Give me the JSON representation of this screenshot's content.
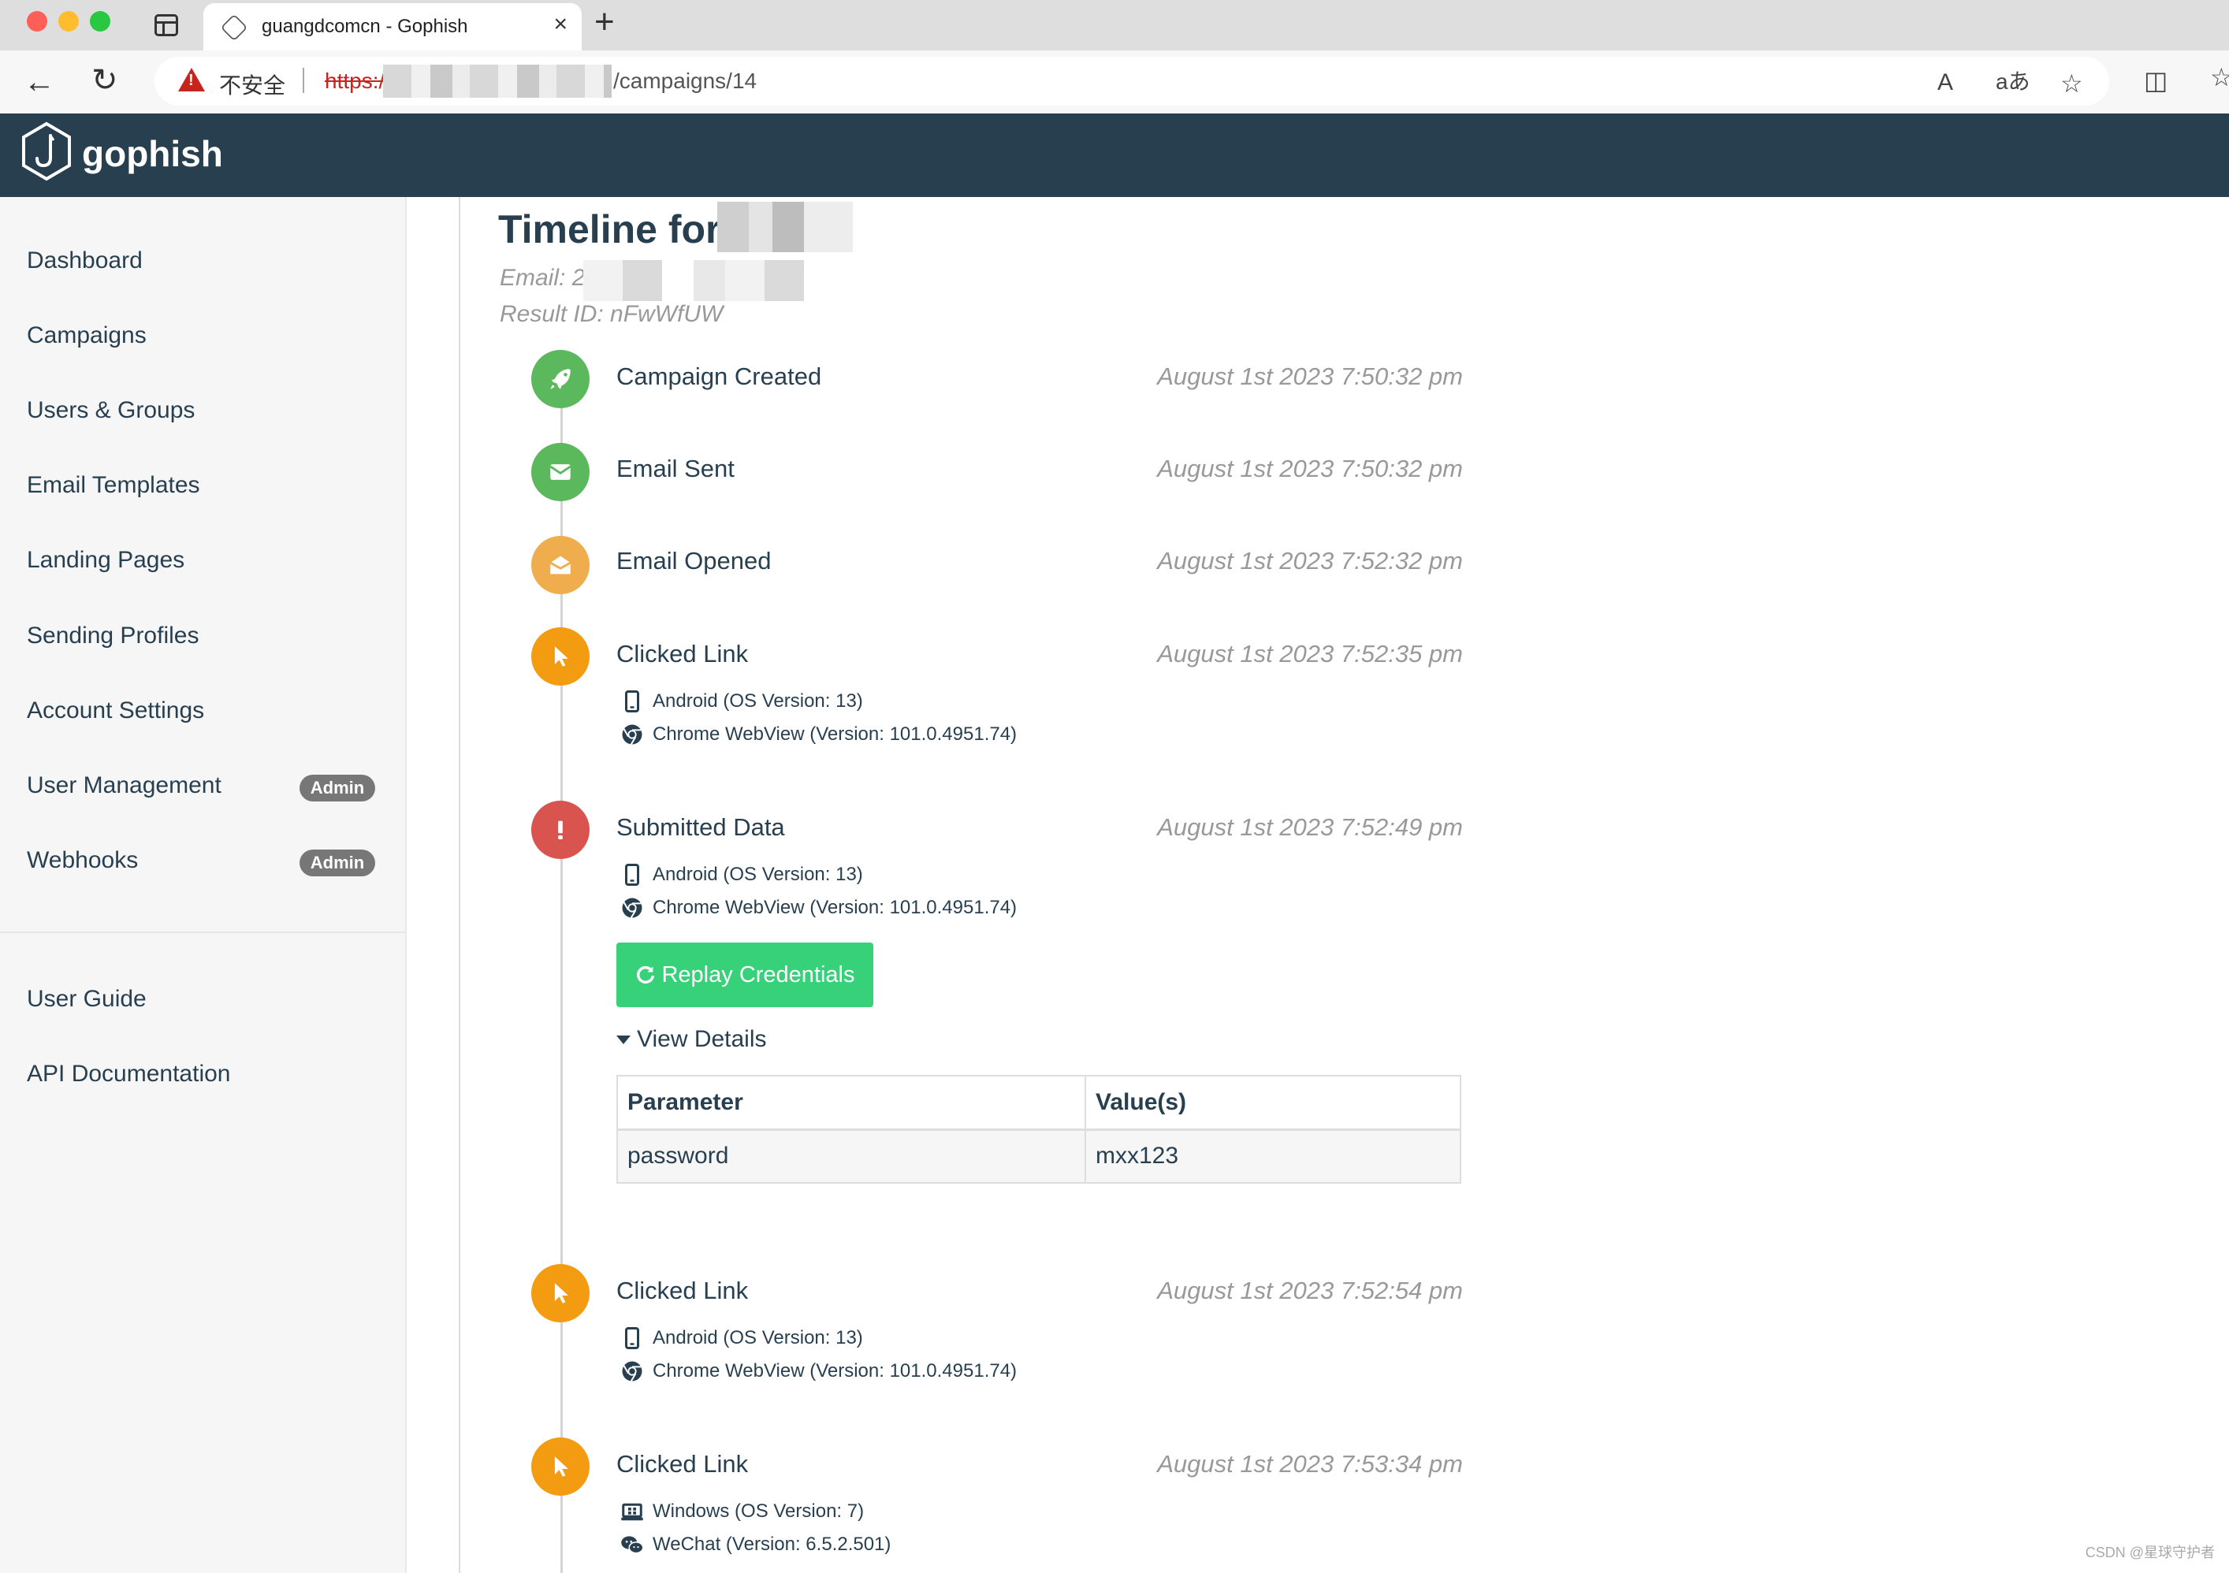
{
  "browser": {
    "tab_title": "guangdcomcn - Gophish",
    "security_warning": "不安全",
    "url_scheme": "https:/",
    "url_path": "/campaigns/14",
    "read_aloud_label": "A",
    "translate_label": "aあ"
  },
  "app": {
    "brand": "gophish"
  },
  "sidebar": {
    "items": [
      {
        "label": "Dashboard"
      },
      {
        "label": "Campaigns"
      },
      {
        "label": "Users & Groups"
      },
      {
        "label": "Email Templates"
      },
      {
        "label": "Landing Pages"
      },
      {
        "label": "Sending Profiles"
      },
      {
        "label": "Account Settings"
      },
      {
        "label": "User Management",
        "badge": "Admin"
      },
      {
        "label": "Webhooks",
        "badge": "Admin"
      }
    ],
    "help_items": [
      {
        "label": "User Guide"
      },
      {
        "label": "API Documentation"
      }
    ]
  },
  "timeline": {
    "title_prefix": "Timeline for",
    "email_prefix": "Email: 2(",
    "result_id": "Result ID: nFwWfUW",
    "events": [
      {
        "message": "Campaign Created",
        "time": "August 1st 2023 7:50:32 pm",
        "icon": "rocket-icon",
        "color": "#5cb85c"
      },
      {
        "message": "Email Sent",
        "time": "August 1st 2023 7:50:32 pm",
        "icon": "envelope-icon",
        "color": "#5cb85c"
      },
      {
        "message": "Email Opened",
        "time": "August 1st 2023 7:52:32 pm",
        "icon": "envelope-open-icon",
        "color": "#f0ad4e"
      },
      {
        "message": "Clicked Link",
        "time": "August 1st 2023 7:52:35 pm",
        "icon": "pointer-icon",
        "color": "#f39c12",
        "os": "Android (OS Version: 13)",
        "browser": "Chrome WebView (Version: 101.0.4951.74)"
      },
      {
        "message": "Submitted Data",
        "time": "August 1st 2023 7:52:49 pm",
        "icon": "exclamation-icon",
        "color": "#d9534f",
        "os": "Android (OS Version: 13)",
        "browser": "Chrome WebView (Version: 101.0.4951.74)"
      },
      {
        "message": "Clicked Link",
        "time": "August 1st 2023 7:52:54 pm",
        "icon": "pointer-icon",
        "color": "#f39c12",
        "os": "Android (OS Version: 13)",
        "browser": "Chrome WebView (Version: 101.0.4951.74)"
      },
      {
        "message": "Clicked Link",
        "time": "August 1st 2023 7:53:34 pm",
        "icon": "pointer-icon",
        "color": "#f39c12",
        "os": "Windows (OS Version: 7)",
        "browser": "WeChat (Version: 6.5.2.501)"
      }
    ],
    "replay_button": "Replay Credentials",
    "view_details": "View Details",
    "details_table": {
      "headers": [
        "Parameter",
        "Value(s)"
      ],
      "rows": [
        [
          "password",
          "mxx123"
        ]
      ]
    }
  },
  "watermark": "CSDN @星球守护者"
}
